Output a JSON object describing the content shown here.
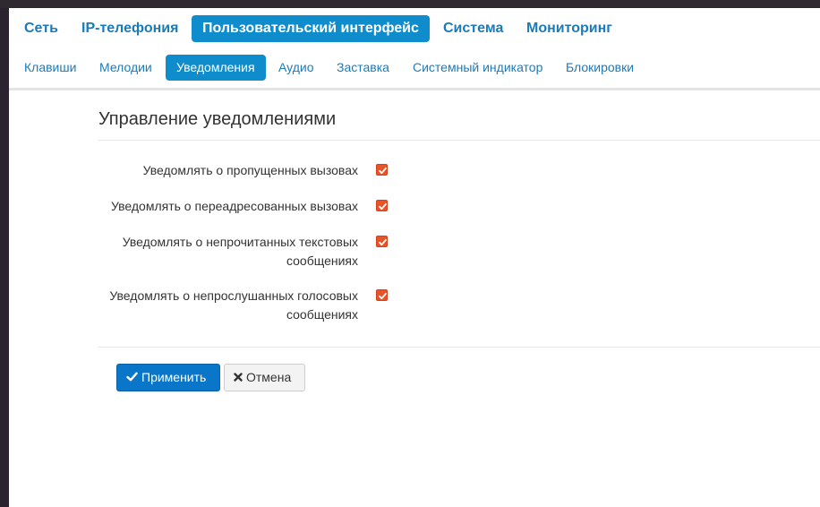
{
  "main_nav": {
    "items": [
      {
        "label": "Сеть"
      },
      {
        "label": "IP-телефония"
      },
      {
        "label": "Пользовательский интерфейс",
        "active": true
      },
      {
        "label": "Система"
      },
      {
        "label": "Мониторинг"
      }
    ]
  },
  "sub_nav": {
    "items": [
      {
        "label": "Клавиши"
      },
      {
        "label": "Мелодии"
      },
      {
        "label": "Уведомления",
        "active": true
      },
      {
        "label": "Аудио"
      },
      {
        "label": "Заставка"
      },
      {
        "label": "Системный индикатор"
      },
      {
        "label": "Блокировки"
      }
    ]
  },
  "section": {
    "title": "Управление уведомлениями",
    "options": [
      {
        "label": "Уведомлять о пропущенных вызовах",
        "checked": true
      },
      {
        "label": "Уведомлять о переадресованных вызовах",
        "checked": true
      },
      {
        "label_line1": "Уведомлять о непрочитанных текстовых",
        "label_line2": "сообщениях",
        "checked": true
      },
      {
        "label_line1": "Уведомлять о непрослушанных голосовых",
        "label_line2": "сообщениях",
        "checked": true
      }
    ]
  },
  "actions": {
    "apply_label": "Применить",
    "cancel_label": "Отмена"
  },
  "colors": {
    "accent": "#0e8ccc",
    "link": "#1b7bb9",
    "checkbox": "#e8542a"
  }
}
